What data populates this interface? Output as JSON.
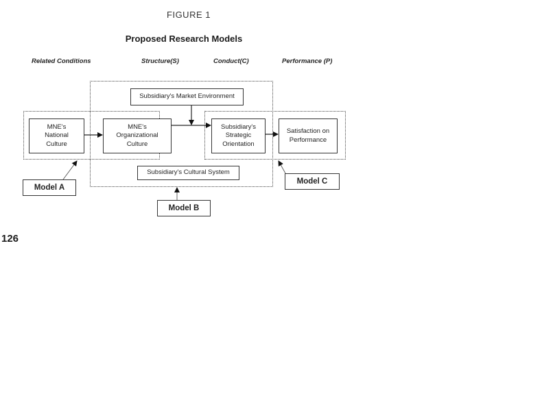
{
  "figure": {
    "label": "FIGURE 1",
    "title": "Proposed Research Models"
  },
  "columns": [
    {
      "label": "Related Conditions"
    },
    {
      "label": "Structure(S)"
    },
    {
      "label": "Conduct(C)"
    },
    {
      "label": "Performance (P)"
    }
  ],
  "nodes": {
    "market_environment": "Subsidiary's Market Environment",
    "national_culture": "MNE's National Culture",
    "organizational_culture": "MNE's Organizational Culture",
    "strategic_orientation": "Subsidiary's Strategic Orientation",
    "satisfaction": "Satisfaction on Performance",
    "cultural_system": "Subsidiary's Cultural System"
  },
  "node_lines": {
    "national_culture": [
      "MNE's",
      "National",
      "Culture"
    ],
    "organizational_culture": [
      "MNE's",
      "Organizational",
      "Culture"
    ],
    "strategic_orientation": [
      "Subsidiary's",
      "Strategic",
      "Orientation"
    ],
    "satisfaction": [
      "Satisfaction on",
      "Performance"
    ]
  },
  "models": {
    "a": "Model A",
    "b": "Model B",
    "c": "Model C"
  },
  "edges": [
    {
      "from": "national_culture",
      "to": "organizational_culture"
    },
    {
      "from": "organizational_culture",
      "to": "strategic_orientation"
    },
    {
      "from": "market_environment",
      "to": "organizational_culture->strategic_orientation"
    },
    {
      "from": "strategic_orientation",
      "to": "satisfaction"
    },
    {
      "from": "model_a_label",
      "to": "model_a_group"
    },
    {
      "from": "model_b_label",
      "to": "model_b_group"
    },
    {
      "from": "model_c_label",
      "to": "model_c_group"
    }
  ],
  "page_number": "126"
}
